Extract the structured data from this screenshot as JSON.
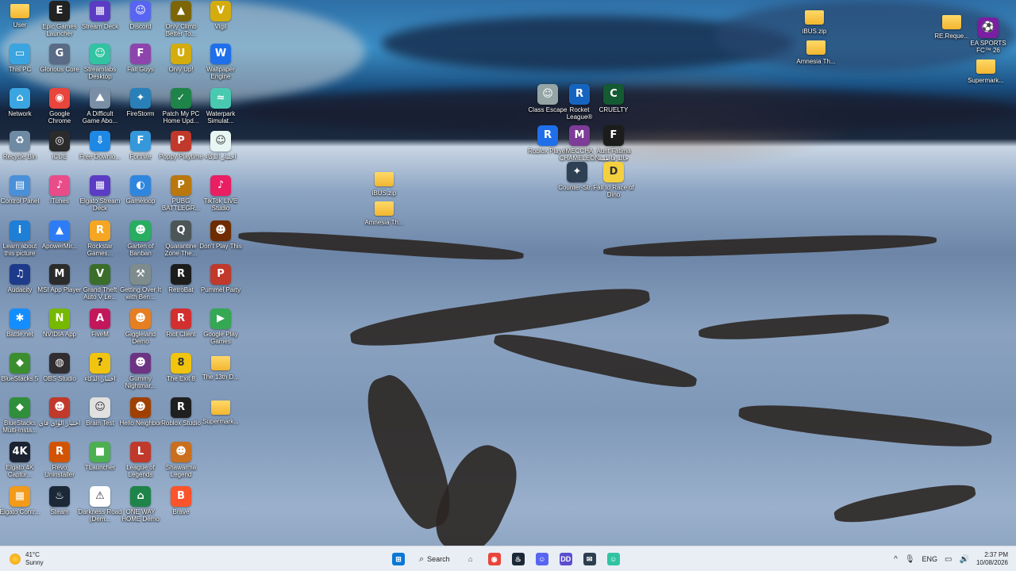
{
  "desktop": {
    "icons": [
      {
        "label": "User",
        "icon": "folder-icon",
        "color": "#f2b630",
        "glyph": ""
      },
      {
        "label": "This PC",
        "icon": "computer-icon",
        "color": "#3aa5e0",
        "glyph": "▭"
      },
      {
        "label": "Network",
        "icon": "network-icon",
        "color": "#3aa5e0",
        "glyph": "⌂"
      },
      {
        "label": "Recycle Bin",
        "icon": "recycle-bin-icon",
        "color": "#6f8aa3",
        "glyph": "♻"
      },
      {
        "label": "Control Panel",
        "icon": "control-panel-icon",
        "color": "#4a90d9",
        "glyph": "▤"
      },
      {
        "label": "Learn about this picture",
        "icon": "info-icon",
        "color": "#1f7fd6",
        "glyph": "i"
      },
      {
        "label": "Audacity",
        "icon": "audacity-icon",
        "color": "#1e3a8a",
        "glyph": "♫"
      },
      {
        "label": "Battle.net",
        "icon": "battlenet-icon",
        "color": "#148eff",
        "glyph": "✱"
      },
      {
        "label": "BlueStacks 5",
        "icon": "bluestacks-icon",
        "color": "#3b8e2e",
        "glyph": "◆"
      },
      {
        "label": "BlueStacks Multi-Insta...",
        "icon": "bluestacks-multi-icon",
        "color": "#2f8f3a",
        "glyph": "◆"
      },
      {
        "label": "Elgato 4K Captur...",
        "icon": "elgato-4k-icon",
        "color": "#1b2230",
        "glyph": "4K"
      },
      {
        "label": "Elgato Contr...",
        "icon": "elgato-control-icon",
        "color": "#f29a1a",
        "glyph": "▦"
      },
      {
        "label": "Epic Games Launcher",
        "icon": "epic-games-icon",
        "color": "#222222",
        "glyph": "E"
      },
      {
        "label": "Glorious Core",
        "icon": "glorious-core-icon",
        "color": "#5a6b86",
        "glyph": "G"
      },
      {
        "label": "Google Chrome",
        "icon": "chrome-icon",
        "color": "#e8453c",
        "glyph": "◉"
      },
      {
        "label": "iCUE",
        "icon": "icue-icon",
        "color": "#2b2b2b",
        "glyph": "◎"
      },
      {
        "label": "iTunes",
        "icon": "itunes-icon",
        "color": "#e84d8a",
        "glyph": "♪"
      },
      {
        "label": "ApowerMir...",
        "icon": "apowermirror-icon",
        "color": "#2d7cf6",
        "glyph": "▲"
      },
      {
        "label": "MSI App Player",
        "icon": "msi-app-player-icon",
        "color": "#2b2b2b",
        "glyph": "M"
      },
      {
        "label": "NVIDIA App",
        "icon": "nvidia-icon",
        "color": "#76b900",
        "glyph": "N"
      },
      {
        "label": "OBS Studio",
        "icon": "obs-icon",
        "color": "#302e31",
        "glyph": "◍"
      },
      {
        "label": "اختبار الواي فاي",
        "icon": "wifi-test-icon",
        "color": "#c0392b",
        "glyph": "☻"
      },
      {
        "label": "Revo Uninstaller",
        "icon": "revo-icon",
        "color": "#d35400",
        "glyph": "R"
      },
      {
        "label": "Steam",
        "icon": "steam-icon",
        "color": "#1b2838",
        "glyph": "♨"
      },
      {
        "label": "Stream Deck",
        "icon": "stream-deck-icon",
        "color": "#5b3cc4",
        "glyph": "▦"
      },
      {
        "label": "Streamlabs Desktop",
        "icon": "streamlabs-icon",
        "color": "#31c3a2",
        "glyph": "☺"
      },
      {
        "label": "A Difficult Game Abo...",
        "icon": "difficult-game-icon",
        "color": "#7a8fa6",
        "glyph": "⛰"
      },
      {
        "label": "Free Downlo...",
        "icon": "free-download-icon",
        "color": "#1e88e5",
        "glyph": "⇩"
      },
      {
        "label": "Elgato Stream Deck",
        "icon": "elgato-stream-deck-icon",
        "color": "#5b3cc4",
        "glyph": "▦"
      },
      {
        "label": "Rockstar Games...",
        "icon": "rockstar-icon",
        "color": "#f5a623",
        "glyph": "R"
      },
      {
        "label": "Grand Theft Auto V Le...",
        "icon": "gta-icon",
        "color": "#3a6e2a",
        "glyph": "V"
      },
      {
        "label": "FiveM",
        "icon": "fivem-icon",
        "color": "#c2185b",
        "glyph": "A"
      },
      {
        "label": "اختبار الذكاء",
        "icon": "iq-test-icon",
        "color": "#f1c40f",
        "glyph": "?"
      },
      {
        "label": "Brain Test",
        "icon": "brain-test-icon",
        "color": "#e0e0e0",
        "glyph": "☺"
      },
      {
        "label": "TLauncher",
        "icon": "tlauncher-icon",
        "color": "#4caf50",
        "glyph": "■"
      },
      {
        "label": "Darkness Road (Dem...",
        "icon": "darkness-road-icon",
        "color": "#ffffff",
        "glyph": "⚠"
      },
      {
        "label": "Discord",
        "icon": "discord-icon",
        "color": "#5865f2",
        "glyph": "☺"
      },
      {
        "label": "Fall Guys",
        "icon": "fall-guys-icon",
        "color": "#8e44ad",
        "glyph": "F"
      },
      {
        "label": "FireStorm",
        "icon": "firestorm-icon",
        "color": "#2980b9",
        "glyph": "✦"
      },
      {
        "label": "Fortnite",
        "icon": "fortnite-icon",
        "color": "#3498db",
        "glyph": "F"
      },
      {
        "label": "Gameloop",
        "icon": "gameloop-icon",
        "color": "#2e86de",
        "glyph": "◐"
      },
      {
        "label": "Garten of Banban",
        "icon": "garten-of-banban-icon",
        "color": "#27ae60",
        "glyph": "☻"
      },
      {
        "label": "Getting Over It with Ben...",
        "icon": "getting-over-it-icon",
        "color": "#7f8c8d",
        "glyph": "⚒"
      },
      {
        "label": "Giggleland Demo",
        "icon": "giggleland-icon",
        "color": "#e67e22",
        "glyph": "☻"
      },
      {
        "label": "Gummy Nightmar...",
        "icon": "gummy-nightmare-icon",
        "color": "#6c3483",
        "glyph": "☻"
      },
      {
        "label": "Hello Neighbor",
        "icon": "hello-neighbor-icon",
        "color": "#a04000",
        "glyph": "☻"
      },
      {
        "label": "League of Legends",
        "icon": "league-icon",
        "color": "#c0392b",
        "glyph": "L"
      },
      {
        "label": "ONE WAY HOME Demo",
        "icon": "one-way-home-icon",
        "color": "#1e8449",
        "glyph": "⌂"
      },
      {
        "label": "Only Climb Better To...",
        "icon": "only-climb-icon",
        "color": "#7d6608",
        "glyph": "▲"
      },
      {
        "label": "Only Up!",
        "icon": "only-up-icon",
        "color": "#d4ac0d",
        "glyph": "U"
      },
      {
        "label": "Patch My PC Home Upd...",
        "icon": "patch-my-pc-icon",
        "color": "#1e8449",
        "glyph": "✓"
      },
      {
        "label": "Poppy Playtime",
        "icon": "poppy-playtime-icon",
        "color": "#c0392b",
        "glyph": "P"
      },
      {
        "label": "PUBG BATTLEGR...",
        "icon": "pubg-icon",
        "color": "#b9770e",
        "glyph": "P"
      },
      {
        "label": "Quarantine Zone The...",
        "icon": "quarantine-zone-icon",
        "color": "#4d5656",
        "glyph": "Q"
      },
      {
        "label": "RetroBat",
        "icon": "retrobat-icon",
        "color": "#1c1c1c",
        "glyph": "R"
      },
      {
        "label": "Riot Client",
        "icon": "riot-client-icon",
        "color": "#d32f2f",
        "glyph": "R"
      },
      {
        "label": "The Exit 8",
        "icon": "exit-8-icon",
        "color": "#f1c40f",
        "glyph": "8"
      },
      {
        "label": "Roblox Studio",
        "icon": "roblox-studio-icon",
        "color": "#1f1f1f",
        "glyph": "R"
      },
      {
        "label": "Shawarma Legend",
        "icon": "shawarma-legend-icon",
        "color": "#ca6f1e",
        "glyph": "☻"
      },
      {
        "label": "Brave",
        "icon": "brave-icon",
        "color": "#fb542b",
        "glyph": "B"
      },
      {
        "label": "Vigil",
        "icon": "vigil-icon",
        "color": "#d4ac0d",
        "glyph": "V"
      },
      {
        "label": "Wallpaper Engine",
        "icon": "wallpaper-engine-icon",
        "color": "#1f6feb",
        "glyph": "W"
      },
      {
        "label": "Waterpark Simulat...",
        "icon": "waterpark-simulator-icon",
        "color": "#48c9b0",
        "glyph": "≈"
      },
      {
        "label": "اختبار الذكاء",
        "icon": "iq-test-2-icon",
        "color": "#e8f6f3",
        "glyph": "☺"
      },
      {
        "label": "TikTok LIVE Studio",
        "icon": "tiktok-live-icon",
        "color": "#e91e63",
        "glyph": "♪"
      },
      {
        "label": "Don't Play This",
        "icon": "dont-play-this-icon",
        "color": "#6e2c00",
        "glyph": "☻"
      },
      {
        "label": "Pummel Party",
        "icon": "pummel-party-icon",
        "color": "#c0392b",
        "glyph": "P"
      },
      {
        "label": "Google Play Games",
        "icon": "google-play-games-icon",
        "color": "#34a853",
        "glyph": "▶"
      },
      {
        "label": "The 13th D...",
        "icon": "folder-icon",
        "color": "#f2b630",
        "glyph": ""
      },
      {
        "label": "Supermark...",
        "icon": "folder-icon",
        "color": "#f2b630",
        "glyph": ""
      },
      {
        "label": "iBUS.zip",
        "icon": "zip-folder-icon",
        "color": "#f2b630",
        "glyph": ""
      },
      {
        "label": "Amnesia Th...",
        "icon": "folder-icon",
        "color": "#f2b630",
        "glyph": ""
      },
      {
        "label": "Class Escape",
        "icon": "class-escape-icon",
        "color": "#95a5a6",
        "glyph": "☺"
      },
      {
        "label": "Rocket League®",
        "icon": "rocket-league-icon",
        "color": "#1565c0",
        "glyph": "R"
      },
      {
        "label": "CRUELTY",
        "icon": "cruelty-icon",
        "color": "#145a32",
        "glyph": "C"
      },
      {
        "label": "Roblox Player",
        "icon": "roblox-player-icon",
        "color": "#1f6feb",
        "glyph": "R"
      },
      {
        "label": "MECCHA CHAMELEON",
        "icon": "meccha-chameleon-icon",
        "color": "#7d3c98",
        "glyph": "M"
      },
      {
        "label": "Aunt Fatima خالة فاطمة",
        "icon": "aunt-fatima-icon",
        "color": "#1c1c1c",
        "glyph": "F"
      },
      {
        "label": "Counter-Str...",
        "icon": "counter-strike-icon",
        "color": "#2e4053",
        "glyph": "✦"
      },
      {
        "label": "Fall to Race of Dino",
        "icon": "fall-race-dino-icon",
        "color": "#f4d03f",
        "glyph": "D"
      },
      {
        "label": "iBUS.zip",
        "icon": "zip-folder-icon",
        "color": "#f2b630",
        "glyph": ""
      },
      {
        "label": "Amnesia Th...",
        "icon": "folder-icon",
        "color": "#f2b630",
        "glyph": ""
      },
      {
        "label": "RE.Reque...",
        "icon": "folder-icon",
        "color": "#f2b630",
        "glyph": ""
      },
      {
        "label": "EA SPORTS FC™ 26",
        "icon": "ea-sports-fc-icon",
        "color": "#7b1fa2",
        "glyph": "⚽"
      },
      {
        "label": "Supermark...",
        "icon": "folder-icon",
        "color": "#f2b630",
        "glyph": ""
      }
    ]
  },
  "taskbar": {
    "weather": {
      "temp": "41°C",
      "condition": "Sunny",
      "icon": "sun-icon"
    },
    "search_label": "Search",
    "apps": [
      {
        "name": "start-button",
        "icon": "windows-logo-icon",
        "color": "#0a78d4",
        "glyph": "⊞"
      },
      {
        "name": "file-explorer-button",
        "icon": "home-icon",
        "color": "#e8eef6",
        "glyph": "⌂"
      },
      {
        "name": "chrome-taskbar-button",
        "icon": "chrome-icon",
        "color": "#e8453c",
        "glyph": "◉"
      },
      {
        "name": "steam-taskbar-button",
        "icon": "steam-icon",
        "color": "#1b2838",
        "glyph": "♨"
      },
      {
        "name": "discord-taskbar-button",
        "icon": "discord-icon",
        "color": "#5865f2",
        "glyph": "☺"
      },
      {
        "name": "dd-taskbar-button",
        "icon": "dd-app-icon",
        "color": "#5b4fd0",
        "glyph": "DD"
      },
      {
        "name": "mail-taskbar-button",
        "icon": "envelope-icon",
        "color": "#2c3e50",
        "glyph": "✉"
      },
      {
        "name": "streamlabs-taskbar-button",
        "icon": "streamlabs-icon",
        "color": "#31c3a2",
        "glyph": "☺"
      }
    ],
    "tray": {
      "chevron": "^",
      "language": "ENG",
      "time": "2:37 PM",
      "date": "10/08/2026"
    }
  }
}
